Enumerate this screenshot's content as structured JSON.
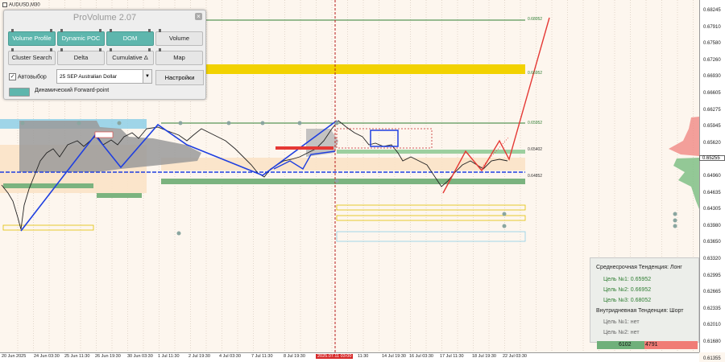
{
  "symbol": "AUDUSD,M30",
  "panel": {
    "title": "ProVolume 2.07",
    "close_label": "×",
    "buttons": {
      "volume_profile": "Volume Profile",
      "dynamic_poc": "Dynamic POC",
      "dom": "DOM",
      "volume": "Volume",
      "cluster_search": "Cluster Search",
      "delta": "Delta",
      "cumulative_delta": "Cumulative Δ",
      "map": "Map"
    },
    "auto_select_label": "Автовыбор",
    "auto_select_checked": true,
    "instrument": "25 SEP Australian Dollar",
    "settings_label": "Настройки",
    "forward_point_label": "Динамический Forward-point"
  },
  "price_axis": {
    "labels": [
      "0.68245",
      "0.67910",
      "0.67580",
      "0.67260",
      "0.66930",
      "0.66605",
      "0.66275",
      "0.65945",
      "0.65620",
      "0.65290",
      "0.64960",
      "0.64635",
      "0.64305",
      "0.63980",
      "0.63650",
      "0.63320",
      "0.62995",
      "0.62665",
      "0.62335",
      "0.62010",
      "0.61680",
      "0.61355"
    ],
    "current_price": "0.65255",
    "current_price_color": "#222222"
  },
  "time_axis": {
    "labels": [
      "20 Jun 2025",
      "24 Jun 03:30",
      "25 Jun 11:30",
      "26 Jun 19:30",
      "30 Jun 03:30",
      "1 Jul 11:30",
      "2 Jul 19:30",
      "4 Jul 03:30",
      "7 Jul 11:30",
      "8 Jul 19:30",
      "2025.07.11 03:00",
      "11:30",
      "14 Jul 19:30",
      "16 Jul 03:30",
      "17 Jul 11:30",
      "18 Jul 19:30",
      "22 Jul 03:30"
    ],
    "highlighted_index": 10
  },
  "levels": {
    "target3": "0.68052",
    "target2": "0.66952",
    "target1": "0.65952",
    "mid": "0.65402",
    "support": "0.64852"
  },
  "trend": {
    "mid_term_title": "Среднесрочная Тенденция: Лонг",
    "mid_targets": [
      "Цель №1: 0.65952",
      "Цель №2: 0.66952",
      "Цель №3: 0.68052"
    ],
    "intraday_title": "Внутридневная Тенденция: Шорт",
    "intraday_targets": [
      "Цель №1: нет",
      "Цель №2: нет"
    ]
  },
  "balance": {
    "buy": "6102",
    "sell": "4791"
  },
  "colors": {
    "background": "#fdf6ee",
    "accent_teal": "#5eb6ad",
    "level_green": "#7bb37f",
    "level_yellow": "#f2d200",
    "level_blue": "#8ecfe6",
    "trend_line_blue": "#1f3fe0",
    "forecast_red": "#e53935"
  }
}
